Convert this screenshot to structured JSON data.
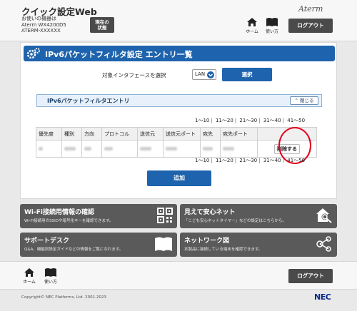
{
  "header": {
    "app_title": "クイック設定Web",
    "device_info": [
      "お使いの機器は",
      "Aterm WX4200D5",
      "ATERM-XXXXXX"
    ],
    "status_button": [
      "現在の",
      "状態"
    ],
    "brand": "Aterm",
    "home_label": "ホーム",
    "help_label": "使い方",
    "logout_label": "ログアウト"
  },
  "main": {
    "page_title": "IPv6パケットフィルタ設定 エントリ一覧",
    "interface_label": "対象インタフェースを選択",
    "interface_value": "LAN",
    "select_button": "選択",
    "section_title": "IPv6パケットフィルタエントリ",
    "collapse_button": "閉じる",
    "pager": [
      "1～10",
      "11～20",
      "21～30",
      "31～40",
      "41～50"
    ],
    "columns": [
      "優先度",
      "種別",
      "方向",
      "プロトコル",
      "送信元",
      "送信元ポート",
      "宛先",
      "宛先ポート",
      ""
    ],
    "delete_button": "削除する",
    "add_button": "追加"
  },
  "tiles": [
    {
      "title": "Wi-Fi接続用情報の確認",
      "desc": "Wi-Fi接続用のSSIDや暗号化キーを確認できます。",
      "icon": "qr-code-icon"
    },
    {
      "title": "見えて安心ネット",
      "desc": "「こども安心ネットタイマー」などの設定はこちらから。",
      "icon": "house-search-icon"
    },
    {
      "title": "サポートデスク",
      "desc": "Q&A、機能別設定ガイドなどの情報をご覧になれます。",
      "icon": "book-icon"
    },
    {
      "title": "ネットワーク図",
      "desc": "本製品に接続している端末を確認できます。",
      "icon": "network-icon"
    }
  ],
  "footer": {
    "home_label": "ホーム",
    "help_label": "使い方",
    "logout_label": "ログアウト",
    "copyright": "Copyright© NEC Platforms, Ltd. 2001-2023",
    "nec_logo": "NEC"
  },
  "colors": {
    "primary": "#1e63ad",
    "tile": "#5a5a5a",
    "highlight": "#e3001b"
  }
}
